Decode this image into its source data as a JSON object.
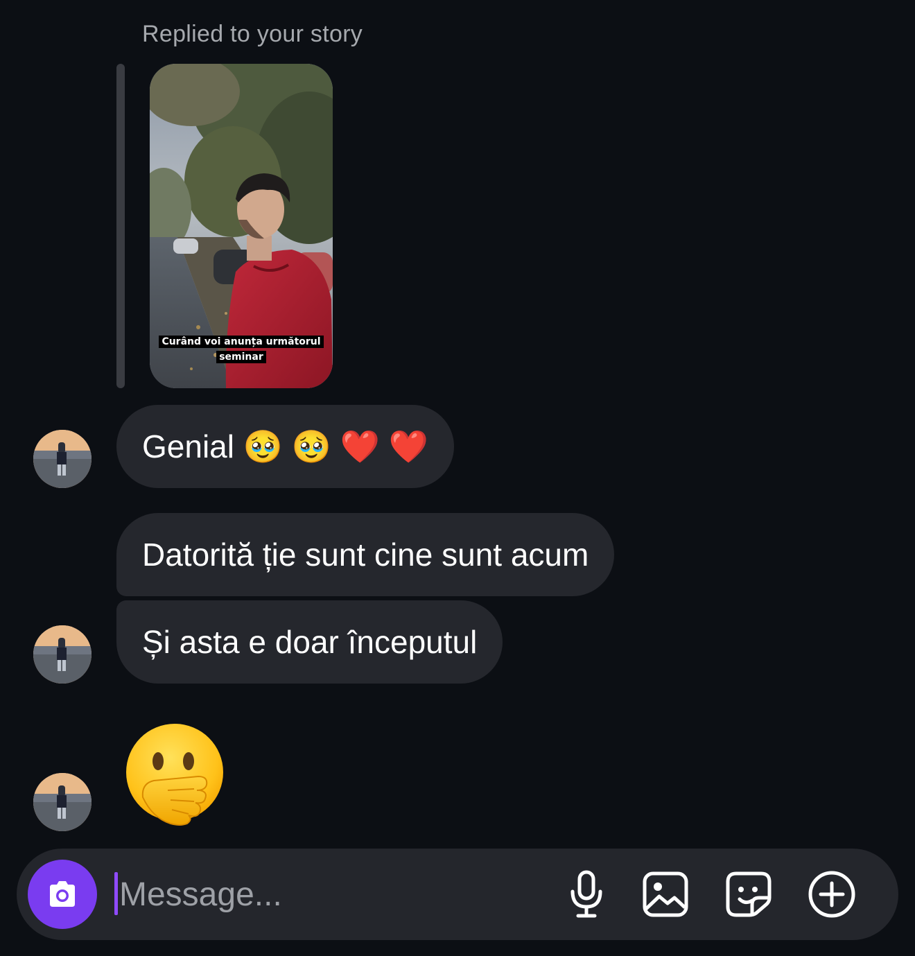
{
  "thread": {
    "replied_label": "Replied to your story",
    "story": {
      "caption": "Curând voi anunța următorul seminar"
    },
    "messages": [
      {
        "text": "Genial 🥹 🥹 ❤️ ❤️"
      },
      {
        "text": "Datorită ție sunt cine sunt acum"
      },
      {
        "text": "Și asta e doar începutul"
      }
    ],
    "sticker_emoji": "hand-over-mouth-face"
  },
  "composer": {
    "placeholder": "Message...",
    "value": ""
  },
  "icons": {
    "camera": "camera-icon",
    "microphone": "microphone-icon",
    "gallery": "gallery-icon",
    "sticker": "sticker-icon",
    "add": "add-circle-icon"
  },
  "colors": {
    "background": "#0c0f14",
    "bubble": "#25272d",
    "accent": "#7a3cf0"
  }
}
